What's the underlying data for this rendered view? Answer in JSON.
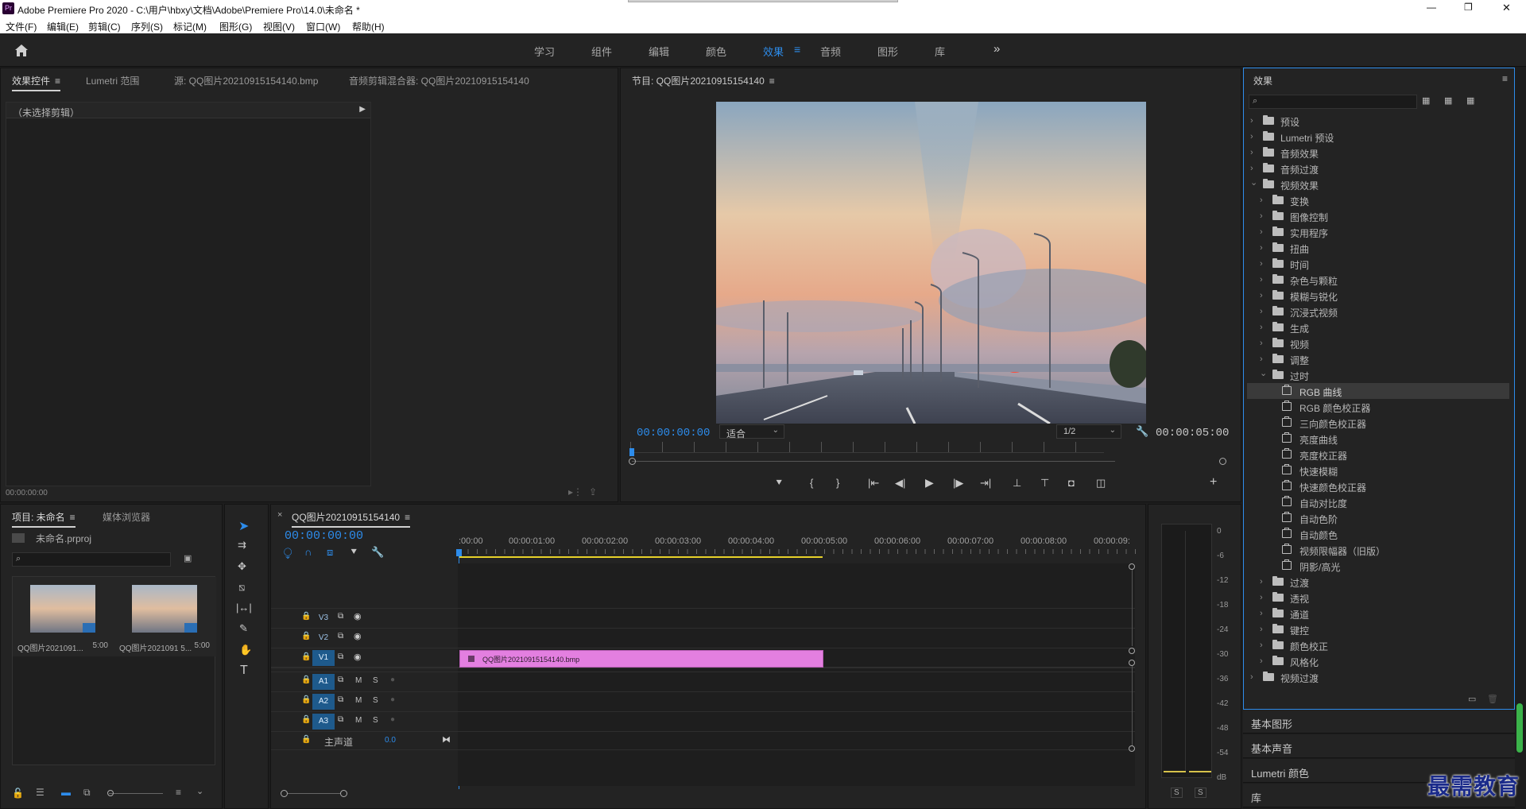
{
  "app": {
    "title": "Adobe Premiere Pro 2020 - C:\\用户\\hbxy\\文档\\Adobe\\Premiere Pro\\14.0\\未命名 *",
    "logo": "Pr"
  },
  "window_controls": {
    "minimize": "—",
    "maximize": "❐",
    "close": "✕"
  },
  "menu": [
    "文件(F)",
    "编辑(E)",
    "剪辑(C)",
    "序列(S)",
    "标记(M)",
    "图形(G)",
    "视图(V)",
    "窗口(W)",
    "帮助(H)"
  ],
  "workspaces": {
    "items": [
      "学习",
      "组件",
      "编辑",
      "颜色",
      "效果",
      "音频",
      "图形",
      "库"
    ],
    "active": "效果",
    "more": "»"
  },
  "effect_controls": {
    "tabs": [
      "效果控件",
      "Lumetri 范围",
      "源: QQ图片20210915154140.bmp",
      "音频剪辑混合器: QQ图片20210915154140"
    ],
    "no_clip": "（未选择剪辑）",
    "timecode": "00:00:00:00"
  },
  "program": {
    "title": "节目: QQ图片20210915154140",
    "timecode": "00:00:00:00",
    "fit": "适合",
    "resolution": "1/2",
    "duration": "00:00:05:00"
  },
  "project": {
    "tabs": [
      "项目: 未命名",
      "媒体浏览器"
    ],
    "file": "未命名.prproj",
    "items": [
      {
        "name": "QQ图片2021091...",
        "duration": "5:00"
      },
      {
        "name": "QQ图片2021091 5...",
        "duration": "5:00"
      }
    ]
  },
  "timeline": {
    "tab": "QQ图片20210915154140",
    "close": "×",
    "timecode": "00:00:00:00",
    "ruler": [
      ":00:00",
      "00:00:01:00",
      "00:00:02:00",
      "00:00:03:00",
      "00:00:04:00",
      "00:00:05:00",
      "00:00:06:00",
      "00:00:07:00",
      "00:00:08:00",
      "00:00:09:"
    ],
    "video_tracks": [
      "V3",
      "V2",
      "V1"
    ],
    "audio_tracks": [
      "A1",
      "A2",
      "A3"
    ],
    "master": {
      "label": "主声道",
      "value": "0.0"
    },
    "track_btns": {
      "mute": "M",
      "solo": "S"
    },
    "clip": {
      "name": "QQ图片20210915154140.bmp",
      "color": "#e37fe0"
    }
  },
  "audio_meter": {
    "scale": [
      "0",
      "-6",
      "-12",
      "-18",
      "-24",
      "-30",
      "-36",
      "-42",
      "-48",
      "-54",
      "dB"
    ],
    "solo": [
      "S",
      "S"
    ]
  },
  "effects": {
    "title": "效果",
    "tree": [
      {
        "depth": 0,
        "type": "folder",
        "special": true,
        "label": "预设",
        "open": false
      },
      {
        "depth": 0,
        "type": "folder",
        "special": true,
        "label": "Lumetri 预设",
        "open": false
      },
      {
        "depth": 0,
        "type": "folder",
        "label": "音频效果",
        "open": false
      },
      {
        "depth": 0,
        "type": "folder",
        "label": "音频过渡",
        "open": false
      },
      {
        "depth": 0,
        "type": "folder",
        "label": "视频效果",
        "open": true
      },
      {
        "depth": 1,
        "type": "folder",
        "label": "变换",
        "open": false
      },
      {
        "depth": 1,
        "type": "folder",
        "label": "图像控制",
        "open": false
      },
      {
        "depth": 1,
        "type": "folder",
        "label": "实用程序",
        "open": false
      },
      {
        "depth": 1,
        "type": "folder",
        "label": "扭曲",
        "open": false
      },
      {
        "depth": 1,
        "type": "folder",
        "label": "时间",
        "open": false
      },
      {
        "depth": 1,
        "type": "folder",
        "label": "杂色与颗粒",
        "open": false
      },
      {
        "depth": 1,
        "type": "folder",
        "label": "模糊与锐化",
        "open": false
      },
      {
        "depth": 1,
        "type": "folder",
        "label": "沉浸式视频",
        "open": false
      },
      {
        "depth": 1,
        "type": "folder",
        "label": "生成",
        "open": false
      },
      {
        "depth": 1,
        "type": "folder",
        "label": "视频",
        "open": false
      },
      {
        "depth": 1,
        "type": "folder",
        "label": "调整",
        "open": false
      },
      {
        "depth": 1,
        "type": "folder",
        "label": "过时",
        "open": true
      },
      {
        "depth": 2,
        "type": "effect",
        "label": "RGB 曲线",
        "selected": true
      },
      {
        "depth": 2,
        "type": "effect",
        "label": "RGB 颜色校正器"
      },
      {
        "depth": 2,
        "type": "effect",
        "label": "三向颜色校正器"
      },
      {
        "depth": 2,
        "type": "effect",
        "label": "亮度曲线"
      },
      {
        "depth": 2,
        "type": "effect",
        "label": "亮度校正器"
      },
      {
        "depth": 2,
        "type": "effect",
        "label": "快速模糊"
      },
      {
        "depth": 2,
        "type": "effect",
        "label": "快速颜色校正器"
      },
      {
        "depth": 2,
        "type": "effect",
        "label": "自动对比度"
      },
      {
        "depth": 2,
        "type": "effect",
        "label": "自动色阶"
      },
      {
        "depth": 2,
        "type": "effect",
        "label": "自动颜色"
      },
      {
        "depth": 2,
        "type": "effect",
        "label": "视频限幅器（旧版）"
      },
      {
        "depth": 2,
        "type": "effect",
        "label": "阴影/高光"
      },
      {
        "depth": 1,
        "type": "folder",
        "label": "过渡",
        "open": false
      },
      {
        "depth": 1,
        "type": "folder",
        "label": "透视",
        "open": false
      },
      {
        "depth": 1,
        "type": "folder",
        "label": "通道",
        "open": false
      },
      {
        "depth": 1,
        "type": "folder",
        "label": "键控",
        "open": false
      },
      {
        "depth": 1,
        "type": "folder",
        "label": "颜色校正",
        "open": false
      },
      {
        "depth": 1,
        "type": "folder",
        "label": "风格化",
        "open": false
      },
      {
        "depth": 0,
        "type": "folder",
        "label": "视频过渡",
        "open": false
      }
    ]
  },
  "collapsed_panels": [
    "基本图形",
    "基本声音",
    "Lumetri 颜色",
    "库"
  ],
  "watermark": "最需教育",
  "colors": {
    "accent": "#2d8ceb",
    "clip": "#e37fe0",
    "workarea": "#e6d12a",
    "watermark": "#1a2a8a"
  }
}
